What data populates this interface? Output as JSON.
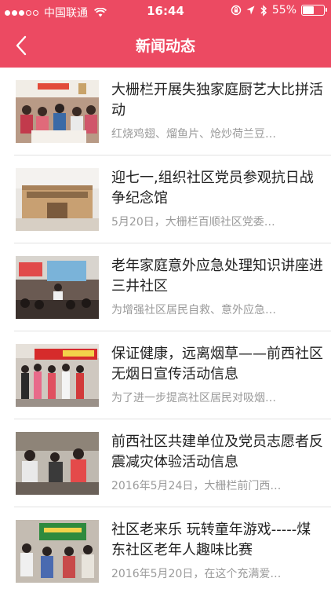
{
  "status_bar": {
    "carrier": "中国联通",
    "time": "16:44",
    "battery": "55%",
    "battery_level": 0.55
  },
  "navbar": {
    "title": "新闻动态",
    "back_icon": "chevron-left-icon"
  },
  "colors": {
    "header": "#ec4a62",
    "summary_text": "#9a9a9a"
  },
  "news": [
    {
      "title": "大栅栏开展失独家庭厨艺大比拼活动",
      "summary": "红烧鸡翅、熘鱼片、炝炒荷兰豆…"
    },
    {
      "title": "迎七一,组织社区党员参观抗日战争纪念馆",
      "summary": "5月20日，大栅栏百顺社区党委…"
    },
    {
      "title": "老年家庭意外应急处理知识讲座进三井社区",
      "summary": "为增强社区居民自救、意外应急…"
    },
    {
      "title": "保证健康，远离烟草——前西社区无烟日宣传活动信息",
      "summary": "为了进一步提高社区居民对吸烟…"
    },
    {
      "title": "前西社区共建单位及党员志愿者反震减灾体验活动信息",
      "summary": "2016年5月24日，大栅栏前门西…"
    },
    {
      "title": "社区老来乐 玩转童年游戏-----煤东社区老年人趣味比赛",
      "summary": "2016年5月20日，在这个充满爱…"
    }
  ]
}
